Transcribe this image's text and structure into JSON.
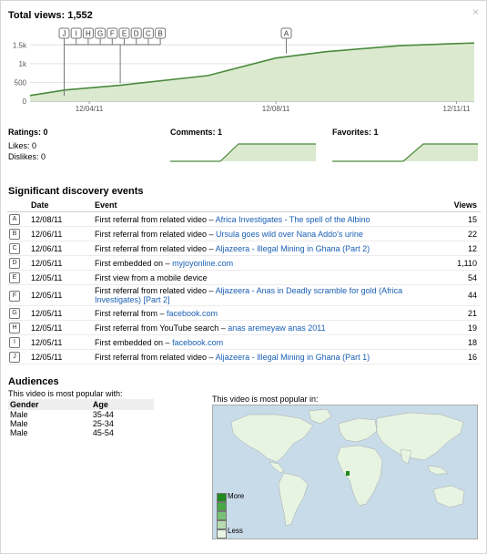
{
  "header": {
    "total_views_label": "Total views: 1,552"
  },
  "chart_data": {
    "type": "area",
    "x_tick_labels": [
      "12/04/11",
      "12/08/11",
      "12/11/11"
    ],
    "y_tick_labels": [
      "0",
      "500",
      "1k",
      "1.5k"
    ],
    "ylim": [
      0,
      1750
    ],
    "x_days": [
      0,
      2,
      4,
      6,
      8,
      10,
      12,
      14
    ],
    "x_dates": [
      "12/04/11",
      "12/05/11",
      "12/06/11",
      "12/07/11",
      "12/08/11",
      "12/09/11",
      "12/10/11",
      "12/11/11"
    ],
    "y": [
      0,
      150,
      300,
      420,
      680,
      1150,
      1320,
      1480,
      1552
    ],
    "event_markers": [
      "J",
      "I",
      "H",
      "G",
      "F",
      "E",
      "D",
      "C",
      "B",
      "A"
    ],
    "colors": {
      "line": "#4a8a3c",
      "fill": "#dbeacf"
    }
  },
  "stats": {
    "ratings": "Ratings: 0",
    "likes": "Likes: 0",
    "dislikes": "Dislikes: 0",
    "comments": "Comments: 1",
    "favorites": "Favorites: 1"
  },
  "events": {
    "title": "Significant discovery events",
    "headers": {
      "date": "Date",
      "event": "Event",
      "views": "Views"
    },
    "rows": [
      {
        "badge": "A",
        "date": "12/08/11",
        "prefix": "First referral from related video – ",
        "link": "Africa Investigates - The spell of the Albino",
        "views": "15"
      },
      {
        "badge": "B",
        "date": "12/06/11",
        "prefix": "First referral from related video – ",
        "link": "Ursula goes wild over Nana Addo's urine",
        "views": "22"
      },
      {
        "badge": "C",
        "date": "12/06/11",
        "prefix": "First referral from related video – ",
        "link": "Aljazeera - Illegal Mining in Ghana (Part 2)",
        "views": "12"
      },
      {
        "badge": "D",
        "date": "12/05/11",
        "prefix": "First embedded on – ",
        "link": "myjoyonline.com",
        "views": "1,110"
      },
      {
        "badge": "E",
        "date": "12/05/11",
        "prefix": "First view from a mobile device",
        "link": "",
        "views": "54"
      },
      {
        "badge": "F",
        "date": "12/05/11",
        "prefix": "First referral from related video – ",
        "link": "Aljazeera - Anas in Deadly scramble for gold (Africa Investigates) [Part 2]",
        "views": "44"
      },
      {
        "badge": "G",
        "date": "12/05/11",
        "prefix": "First referral from – ",
        "link": "facebook.com",
        "views": "21"
      },
      {
        "badge": "H",
        "date": "12/05/11",
        "prefix": "First referral from YouTube search – ",
        "link": "anas aremeyaw anas 2011",
        "views": "19"
      },
      {
        "badge": "I",
        "date": "12/05/11",
        "prefix": "First embedded on – ",
        "link": "facebook.com",
        "views": "18"
      },
      {
        "badge": "J",
        "date": "12/05/11",
        "prefix": "First referral from related video – ",
        "link": "Aljazeera - Illegal Mining in Ghana (Part 1)",
        "views": "16"
      }
    ]
  },
  "audiences": {
    "title": "Audiences",
    "popular_with": "This video is most popular with:",
    "headers": {
      "gender": "Gender",
      "age": "Age"
    },
    "rows": [
      {
        "gender": "Male",
        "age": "35-44"
      },
      {
        "gender": "Male",
        "age": "25-34"
      },
      {
        "gender": "Male",
        "age": "45-54"
      }
    ],
    "popular_in": "This video is most popular in:",
    "legend_more": "More",
    "legend_less": "Less",
    "legend_colors": [
      "#1f8a1f",
      "#46a846",
      "#76c176",
      "#b5dcb0",
      "#e8f4e2"
    ]
  },
  "close_icon": "×"
}
